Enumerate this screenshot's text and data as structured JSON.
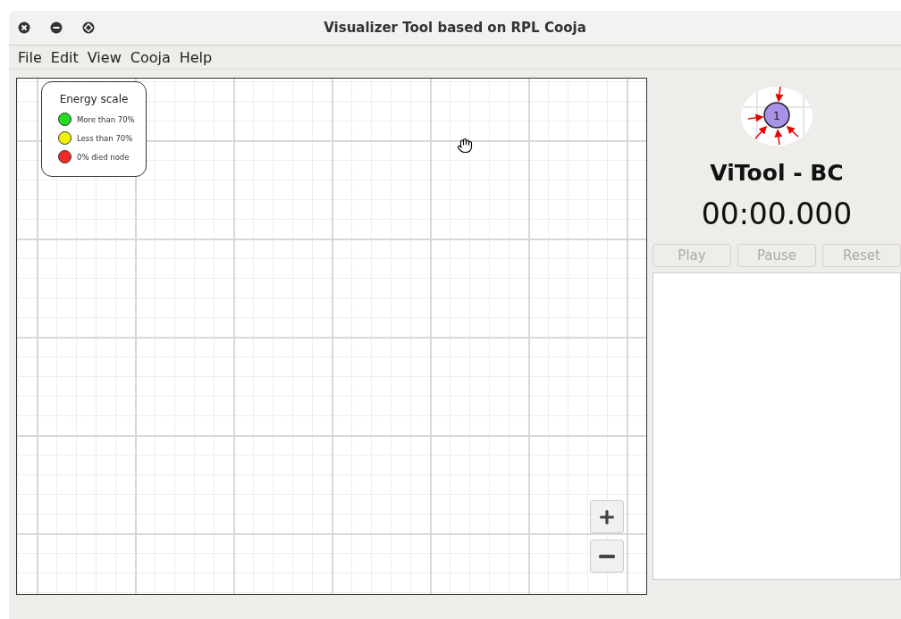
{
  "window": {
    "title": "Visualizer Tool based on RPL Cooja"
  },
  "menu": [
    "File",
    "Edit",
    "View",
    "Cooja",
    "Help"
  ],
  "legend": {
    "title": "Energy scale",
    "items": [
      {
        "label": "More than 70%",
        "color": "#22dd22"
      },
      {
        "label": "Less than 70%",
        "color": "#f2f200"
      },
      {
        "label": "0% died node",
        "color": "#ee2a2a"
      }
    ]
  },
  "logo": {
    "node_label": "1"
  },
  "app_name": "ViTool - BC",
  "timer": "00:00.000",
  "buttons": [
    {
      "label": "Play",
      "disabled": true
    },
    {
      "label": "Pause",
      "disabled": true
    },
    {
      "label": "Reset",
      "disabled": true
    }
  ]
}
